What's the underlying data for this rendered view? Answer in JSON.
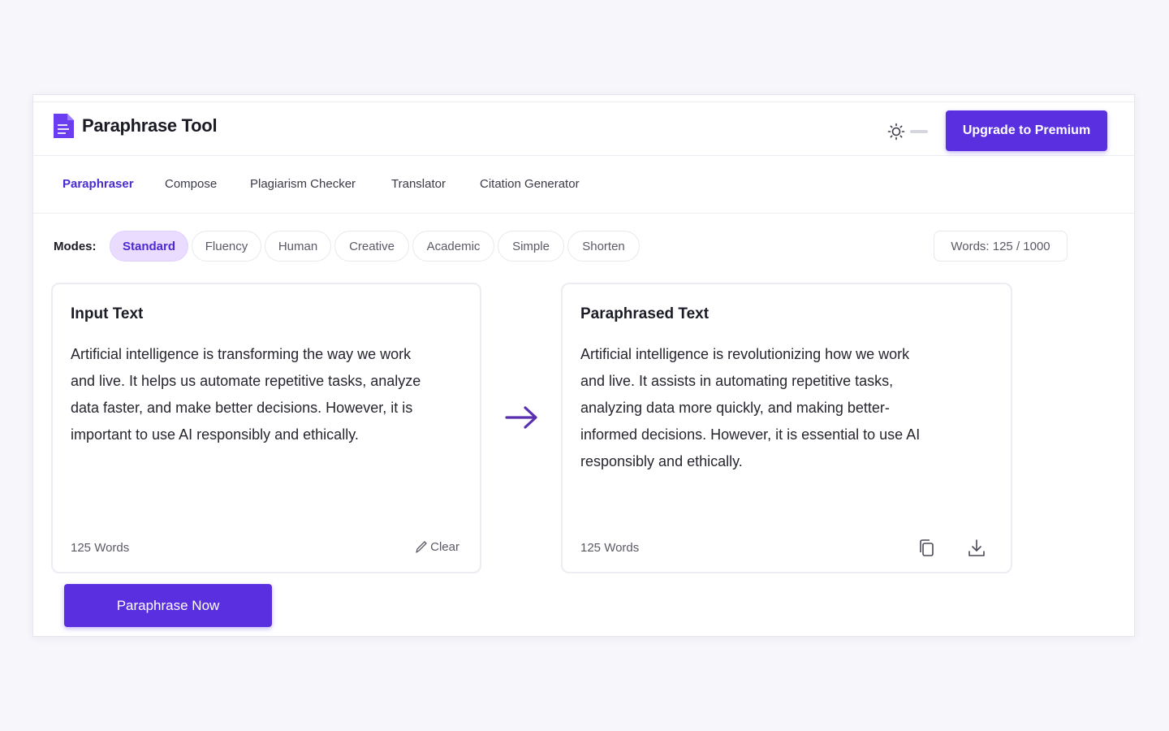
{
  "app": {
    "title": "Paraphrase Tool"
  },
  "header": {
    "upgrade_label": "Upgrade to Premium"
  },
  "nav": {
    "items": [
      {
        "label": "Paraphraser",
        "active": true
      },
      {
        "label": "Compose"
      },
      {
        "label": "Plagiarism Checker"
      },
      {
        "label": "Translator"
      },
      {
        "label": "Citation Generator"
      }
    ]
  },
  "modes": {
    "label": "Modes:",
    "items": [
      "Standard",
      "Fluency",
      "Human",
      "Creative",
      "Academic",
      "Simple",
      "Shorten"
    ],
    "selected": "Standard"
  },
  "word_limit": {
    "label": "Words: 125 / 1000"
  },
  "input_panel": {
    "title": "Input Text",
    "text": "Artificial intelligence is transforming the way we work and live. It helps us automate repetitive tasks, analyze data faster, and make better decisions. However, it is important to use AI responsibly and ethically.",
    "word_count": "125 Words",
    "clear_label": "Clear"
  },
  "output_panel": {
    "title": "Paraphrased Text",
    "text": "Artificial intelligence is revolutionizing how we work and live. It assists in automating repetitive tasks, analyzing data more quickly, and making better-informed decisions. However, it is essential to use AI responsibly and ethically.",
    "word_count": "125 Words"
  },
  "actions": {
    "paraphrase_label": "Paraphrase Now"
  },
  "colors": {
    "accent": "#5a2fe0",
    "active_chip_bg": "#e9dcff",
    "active_text": "#4b2bd0"
  },
  "icons": [
    "document-logo-icon",
    "sun-icon",
    "arrow-right-icon",
    "pencil-icon",
    "copy-icon",
    "download-icon"
  ]
}
